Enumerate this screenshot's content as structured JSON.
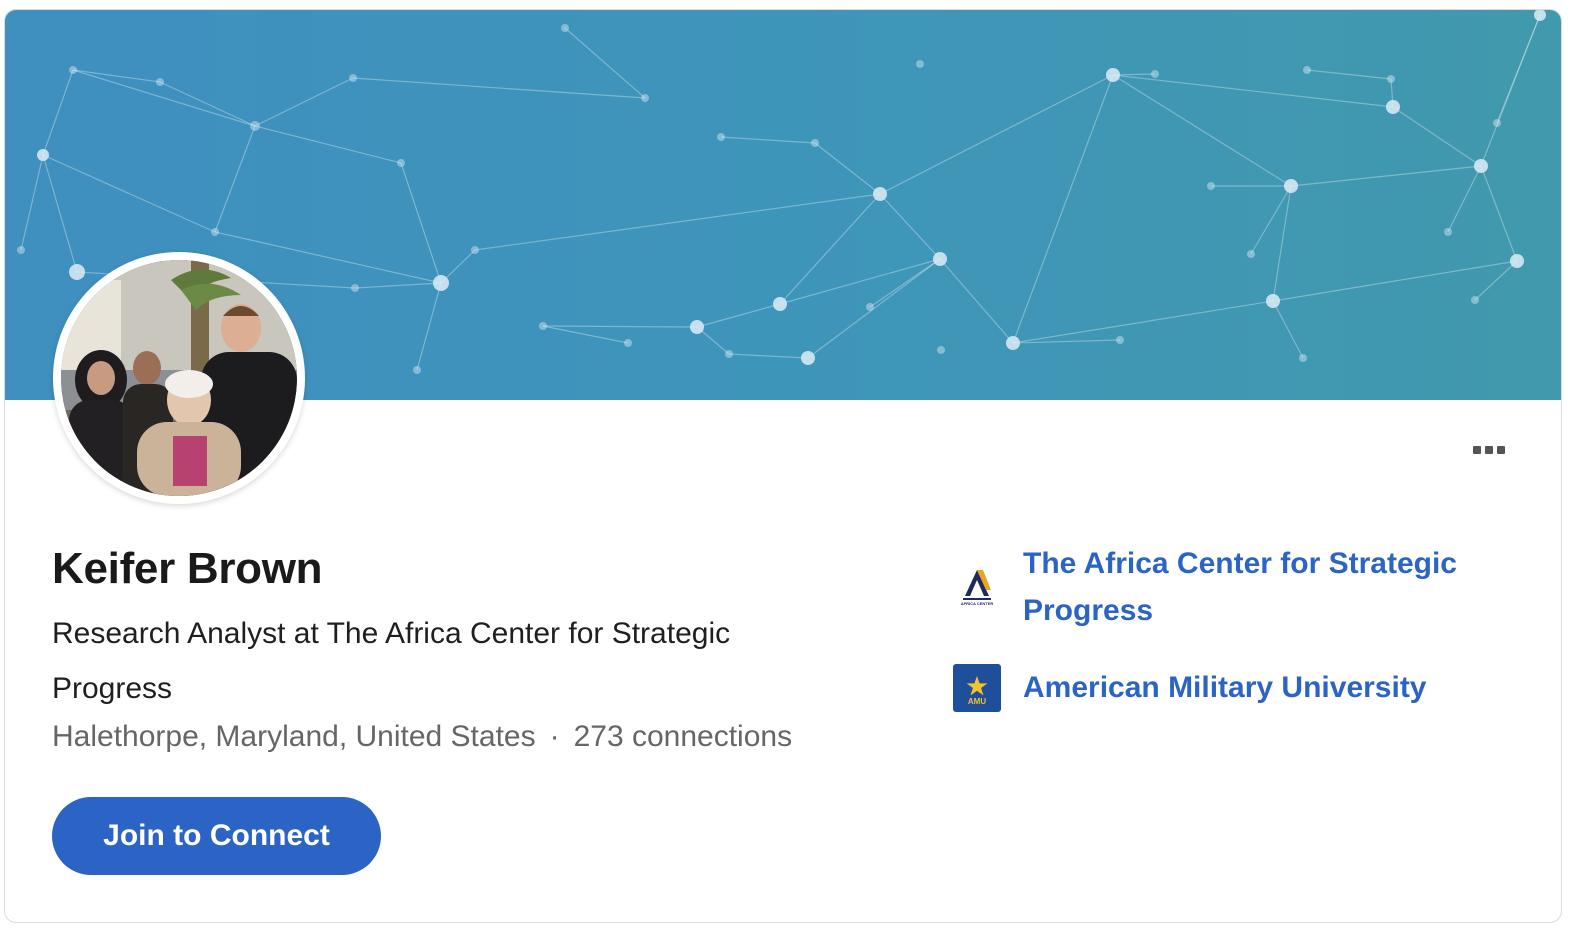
{
  "profile": {
    "name": "Keifer Brown",
    "headline": "Research Analyst at The Africa Center for Strategic Progress",
    "location": "Halethorpe, Maryland, United States",
    "separator": "·",
    "connections": "273 connections"
  },
  "actions": {
    "join_label": "Join to Connect",
    "more_icon": "more-horizontal-icon"
  },
  "organizations": [
    {
      "name": "The Africa Center for Strategic Progress",
      "logo_icon": "africa-center-logo",
      "logo_text": "AFRICA CENTER"
    },
    {
      "name": "American Military University",
      "logo_icon": "amu-logo",
      "logo_text": "AMU"
    }
  ],
  "colors": {
    "accent": "#2b64c4",
    "banner_start": "#3f8fbf",
    "banner_end": "#4199ad"
  }
}
